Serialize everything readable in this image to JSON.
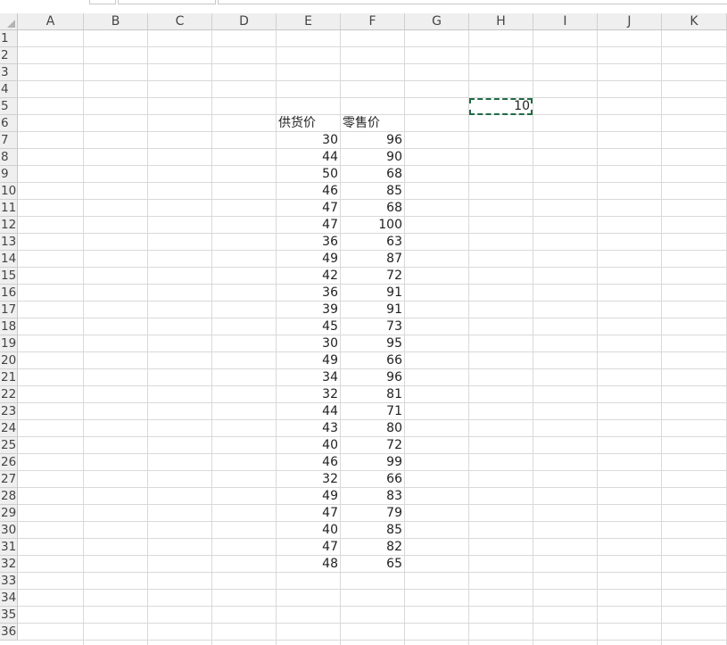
{
  "columns": [
    "A",
    "B",
    "C",
    "D",
    "E",
    "F",
    "G",
    "H",
    "I",
    "J",
    "K"
  ],
  "rows": [
    "1",
    "2",
    "3",
    "4",
    "5",
    "6",
    "7",
    "8",
    "9",
    "10",
    "11",
    "12",
    "13",
    "14",
    "15",
    "16",
    "17",
    "18",
    "19",
    "20",
    "21",
    "22",
    "23",
    "24",
    "25",
    "26",
    "27",
    "28",
    "29",
    "30",
    "31",
    "32",
    "33",
    "34",
    "35",
    "36"
  ],
  "sheet": {
    "headers": {
      "supply_price": "供货价",
      "retail_price": "零售价"
    },
    "supply_price_values": [
      "30",
      "44",
      "50",
      "46",
      "47",
      "47",
      "36",
      "49",
      "42",
      "36",
      "39",
      "45",
      "30",
      "49",
      "34",
      "32",
      "44",
      "43",
      "40",
      "46",
      "32",
      "49",
      "47",
      "40",
      "47",
      "48"
    ],
    "retail_price_values": [
      "96",
      "90",
      "68",
      "85",
      "68",
      "100",
      "63",
      "87",
      "72",
      "91",
      "91",
      "73",
      "95",
      "66",
      "96",
      "81",
      "71",
      "80",
      "72",
      "99",
      "66",
      "83",
      "79",
      "85",
      "82",
      "65"
    ],
    "selected_cell": {
      "ref": "H5",
      "value": "10"
    }
  },
  "colors": {
    "grid": "#d9d9d9",
    "header_bg": "#efefef",
    "selection": "#1e6b46"
  }
}
